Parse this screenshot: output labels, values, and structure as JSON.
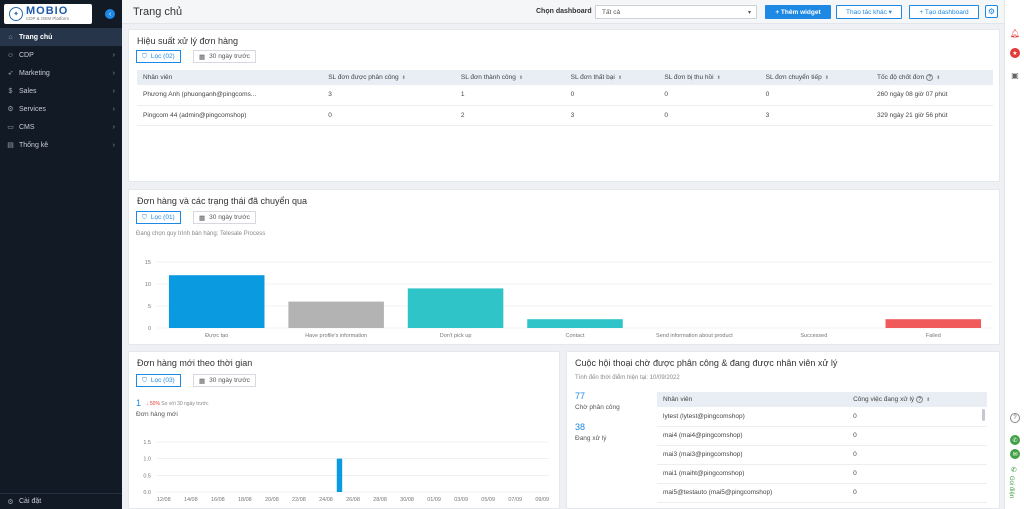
{
  "logo": {
    "name": "MOBIO",
    "subtitle": "CDP & OEM Platform"
  },
  "sidebar": {
    "items": [
      {
        "label": "Trang chủ",
        "icon": "home-icon",
        "glyph": "⌂",
        "active": true,
        "chevron": ""
      },
      {
        "label": "CDP",
        "icon": "user-icon",
        "glyph": "☺",
        "active": false,
        "chevron": "›"
      },
      {
        "label": "Marketing",
        "icon": "rocket-icon",
        "glyph": "➶",
        "active": false,
        "chevron": "›"
      },
      {
        "label": "Sales",
        "icon": "money-icon",
        "glyph": "$",
        "active": false,
        "chevron": "›"
      },
      {
        "label": "Services",
        "icon": "gear-icon",
        "glyph": "⚙",
        "active": false,
        "chevron": "›"
      },
      {
        "label": "CMS",
        "icon": "monitor-icon",
        "glyph": "▭",
        "active": false,
        "chevron": "›"
      },
      {
        "label": "Thống kê",
        "icon": "chart-icon",
        "glyph": "▤",
        "active": false,
        "chevron": "›"
      }
    ],
    "settings_label": "Cài đặt"
  },
  "topbar": {
    "title": "Trang chủ",
    "dashboard_label": "Chọn dashboard",
    "dashboard_value": "Tất cả",
    "add_widget": "+ Thêm widget",
    "actions": "Thao tác khác ▾",
    "create_dashboard": "+ Tạo dashboard"
  },
  "card1": {
    "title": "Hiệu suất xử lý đơn hàng",
    "filter": "Lọc (02)",
    "date": "30 ngày trước",
    "columns": [
      "Nhân viên",
      "SL đơn được phân công",
      "SL đơn thành công",
      "SL đơn thất bại",
      "SL đơn bị thu hồi",
      "SL đơn chuyển tiếp",
      "Tốc độ chốt đơn"
    ],
    "rows": [
      [
        "Phương Anh (phuonganh@pingcoms...",
        "3",
        "1",
        "0",
        "0",
        "0",
        "260 ngày 08 giờ 07 phút"
      ],
      [
        "Pingcom 44 (admin@pingcomshop)",
        "0",
        "2",
        "3",
        "0",
        "3",
        "329 ngày 21 giờ 56 phút"
      ]
    ]
  },
  "card2": {
    "title": "Đơn hàng và các trạng thái đã chuyển qua",
    "filter": "Lọc (01)",
    "date": "30 ngày trước",
    "note": "Đang chọn quy trình bán hàng: Telesale Process"
  },
  "card3": {
    "title": "Đơn hàng mới theo thời gian",
    "filter": "Lọc (03)",
    "date": "30 ngày trước",
    "stat_value": "1",
    "stat_delta": "↓ 50%",
    "stat_compare": "So với 30 ngày trước",
    "stat_label": "Đơn hàng mới"
  },
  "card4": {
    "title": "Cuộc hội thoại chờ được phân công & đang được nhân viên xử lý",
    "note": "Tính đến thời điểm hiện tại: 10/09/2022",
    "waiting_value": "77",
    "waiting_label": "Chờ phân công",
    "processing_value": "38",
    "processing_label": "Đang xử lý",
    "columns": [
      "Nhân viên",
      "Công việc đang xử lý"
    ],
    "rows": [
      [
        "lytest (lytest@pingcomshop)",
        "0"
      ],
      [
        "mai4 (mai4@pingcomshop)",
        "0"
      ],
      [
        "mai3 (mai3@pingcomshop)",
        "0"
      ],
      [
        "mai1 (maiht@pingcomshop)",
        "0"
      ],
      [
        "mai5@testauto (mai5@pingcomshop)",
        "0"
      ]
    ]
  },
  "rightbar": {
    "call_label": "Gọi điện"
  },
  "chart_data": [
    {
      "type": "bar",
      "categories": [
        "Được tạo",
        "Have profile's information",
        "Don't pick up",
        "Contact",
        "Send information about product",
        "Successed",
        "Failed"
      ],
      "values": [
        12,
        6,
        9,
        2,
        0,
        0,
        2
      ],
      "colors": [
        "#0a9ae0",
        "#b3b3b3",
        "#2ec4c8",
        "#2ec4c8",
        "#2ec4c8",
        "#2ec4c8",
        "#f05a5a"
      ],
      "ylim": [
        0,
        15
      ],
      "yticks": [
        "0",
        "5",
        "10",
        "15"
      ],
      "grid": true
    },
    {
      "type": "bar",
      "categories": [
        "12/08",
        "14/08",
        "16/08",
        "18/08",
        "20/08",
        "22/08",
        "24/08",
        "26/08",
        "28/08",
        "30/08",
        "01/09",
        "03/09",
        "05/09",
        "07/09",
        "09/09"
      ],
      "x": [
        "12/08",
        "13/08",
        "14/08",
        "15/08",
        "16/08",
        "17/08",
        "18/08",
        "19/08",
        "20/08",
        "21/08",
        "22/08",
        "23/08",
        "24/08",
        "25/08",
        "26/08",
        "27/08",
        "28/08",
        "29/08",
        "30/08",
        "31/08",
        "01/09",
        "02/09",
        "03/09",
        "04/09",
        "05/09",
        "06/09",
        "07/09",
        "08/09",
        "09/09"
      ],
      "values": [
        0,
        0,
        0,
        0,
        0,
        0,
        0,
        0,
        0,
        0,
        0,
        0,
        0,
        1,
        0,
        0,
        0,
        0,
        0,
        0,
        0,
        0,
        0,
        0,
        0,
        0,
        0,
        0,
        0
      ],
      "color": "#0a9ae0",
      "ylim": [
        0,
        1.5
      ],
      "yticks": [
        "0.0",
        "0.5",
        "1.0",
        "1.5"
      ],
      "grid": true
    }
  ]
}
